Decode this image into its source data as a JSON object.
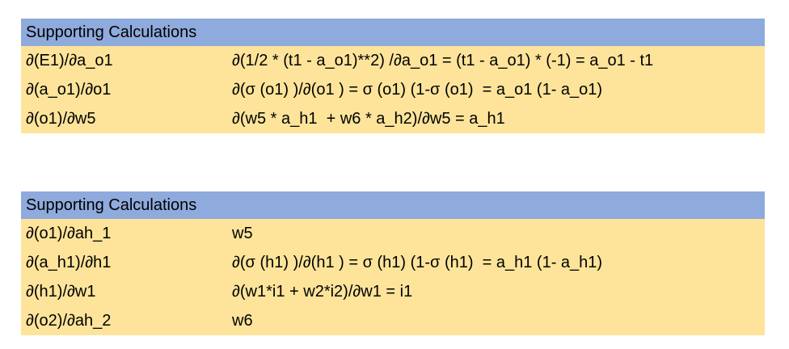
{
  "tables": [
    {
      "header": "Supporting Calculations",
      "rows": [
        {
          "label": "∂(E1)/∂a_o1",
          "formula": "∂(1/2 * (t1 - a_o1)**2) /∂a_o1 = (t1 - a_o1) * (-1) = a_o1 - t1"
        },
        {
          "label": "∂(a_o1)/∂o1",
          "formula": "∂(σ (o1) )/∂(o1 ) = σ (o1) (1-σ (o1)  = a_o1 (1- a_o1)"
        },
        {
          "label": "∂(o1)/∂w5",
          "formula": "∂(w5 * a_h1  + w6 * a_h2)/∂w5 = a_h1"
        }
      ]
    },
    {
      "header": "Supporting Calculations",
      "rows": [
        {
          "label": "∂(o1)/∂ah_1",
          "formula": "w5"
        },
        {
          "label": "∂(a_h1)/∂h1",
          "formula": "∂(σ (h1) )/∂(h1 ) = σ (h1) (1-σ (h1)  = a_h1 (1- a_h1)"
        },
        {
          "label": "∂(h1)/∂w1",
          "formula": "∂(w1*i1 + w2*i2)/∂w1 = i1"
        },
        {
          "label": "∂(o2)/∂ah_2",
          "formula": "w6"
        }
      ]
    }
  ],
  "colors": {
    "header_background": "#8faadc",
    "row_background": "#fde49a"
  }
}
